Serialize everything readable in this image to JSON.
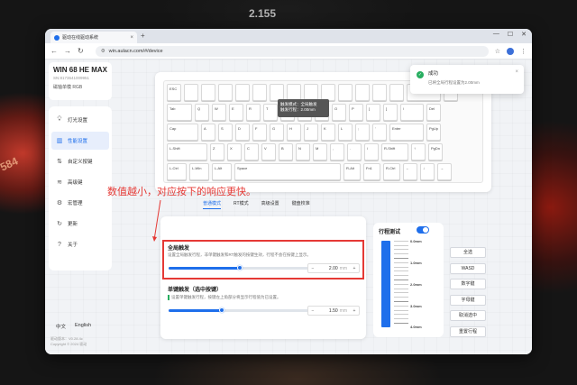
{
  "background": {
    "digits": "2.155",
    "side_text": "584"
  },
  "browser": {
    "tab_title": "驱动在线驱动系统",
    "url": "win.aulacn.com/#/device"
  },
  "device": {
    "name": "WIN 68 HE MAX",
    "sn": "SN:8173641009951",
    "mode": "磁轴单模 RGB"
  },
  "sidebar": {
    "items": [
      {
        "label": "灯光设置",
        "icon": "bulb-icon"
      },
      {
        "label": "性能设置",
        "icon": "bars-icon",
        "active": true
      },
      {
        "label": "自定义按键",
        "icon": "key-remap-icon"
      },
      {
        "label": "高级键",
        "icon": "wifi-icon"
      },
      {
        "label": "宏管理",
        "icon": "gear-icon"
      },
      {
        "label": "更新",
        "icon": "refresh-icon"
      },
      {
        "label": "关于",
        "icon": "question-icon"
      }
    ]
  },
  "language": {
    "zh": "中文",
    "en": "English"
  },
  "version": {
    "line1": "驱动版本：V0.28.4c",
    "line2": "Copyright © 2024 驱动"
  },
  "keyboard": {
    "rows": [
      [
        {
          "l": "ESC",
          "w": 16
        },
        {
          "l": "",
          "w": 16
        },
        {
          "l": "",
          "w": 16
        },
        {
          "l": "",
          "w": 16
        },
        {
          "l": "",
          "w": 16
        },
        {
          "l": "",
          "w": 16
        },
        {
          "l": "",
          "w": 16
        },
        {
          "l": "",
          "w": 16
        },
        {
          "l": "",
          "w": 16
        },
        {
          "l": "",
          "w": 16
        },
        {
          "l": "",
          "w": 16
        },
        {
          "l": "",
          "w": 16
        },
        {
          "l": "",
          "w": 16
        },
        {
          "l": "",
          "w": 16
        },
        {
          "l": "",
          "w": 38
        },
        {
          "l": "",
          "w": 16
        }
      ],
      [
        {
          "l": "Tab",
          "w": 28
        },
        {
          "l": "Q",
          "w": 16
        },
        {
          "l": "W",
          "w": 16
        },
        {
          "l": "E",
          "w": 16
        },
        {
          "l": "R",
          "w": 16
        },
        {
          "l": "T",
          "w": 16
        },
        {
          "l": "Y",
          "w": 16
        },
        {
          "l": "U",
          "w": 16
        },
        {
          "l": "I",
          "w": 16
        },
        {
          "l": "O",
          "w": 16
        },
        {
          "l": "P",
          "w": 16
        },
        {
          "l": "[",
          "w": 16
        },
        {
          "l": "]",
          "w": 16
        },
        {
          "l": "\\",
          "w": 26
        },
        {
          "l": "Del",
          "w": 16
        }
      ],
      [
        {
          "l": "Cap",
          "w": 35
        },
        {
          "l": "A",
          "w": 16
        },
        {
          "l": "S",
          "w": 16
        },
        {
          "l": "D",
          "w": 16
        },
        {
          "l": "F",
          "w": 16
        },
        {
          "l": "G",
          "w": 16
        },
        {
          "l": "H",
          "w": 16
        },
        {
          "l": "J",
          "w": 16
        },
        {
          "l": "K",
          "w": 16
        },
        {
          "l": "L",
          "w": 16
        },
        {
          "l": ";",
          "w": 16
        },
        {
          "l": "'",
          "w": 16
        },
        {
          "l": "Enter",
          "w": 38
        },
        {
          "l": "PgUp",
          "w": 16
        }
      ],
      [
        {
          "l": "L-Shift",
          "w": 45
        },
        {
          "l": "Z",
          "w": 16
        },
        {
          "l": "X",
          "w": 16
        },
        {
          "l": "C",
          "w": 16
        },
        {
          "l": "V",
          "w": 16
        },
        {
          "l": "B",
          "w": 16
        },
        {
          "l": "N",
          "w": 16
        },
        {
          "l": "M",
          "w": 16
        },
        {
          "l": ",",
          "w": 16
        },
        {
          "l": ".",
          "w": 16
        },
        {
          "l": "/",
          "w": 16
        },
        {
          "l": "R-Shift",
          "w": 30
        },
        {
          "l": "↑",
          "w": 16
        },
        {
          "l": "PgDn",
          "w": 16
        }
      ],
      [
        {
          "l": "L-Ctrl",
          "w": 22
        },
        {
          "l": "L-Win",
          "w": 22
        },
        {
          "l": "L-Alt",
          "w": 22
        },
        {
          "l": "Space",
          "w": 118
        },
        {
          "l": "R-Alt",
          "w": 19
        },
        {
          "l": "Fn1",
          "w": 19
        },
        {
          "l": "R-Ctrl",
          "w": 19
        },
        {
          "l": "←",
          "w": 16
        },
        {
          "l": "↓",
          "w": 16
        },
        {
          "l": "→",
          "w": 16
        }
      ]
    ],
    "tooltip": {
      "line1": "触发模式：全局触发",
      "line2": "触发行程：2.00mm"
    }
  },
  "toast": {
    "title": "成功",
    "desc": "已将全局行程设置为2.00mm"
  },
  "annotation": "数值越小，对应按下的响应更快。",
  "tabs": [
    {
      "label": "普通模式",
      "active": true
    },
    {
      "label": "RT模式"
    },
    {
      "label": "高级设置"
    },
    {
      "label": "键盘校准"
    }
  ],
  "global_trigger": {
    "title": "全局触发",
    "desc": "设置全局触发行程，非单键触发和RT触发的按键生效，行程不会在按键上显示。",
    "value": "2.00",
    "unit": "mm",
    "fraction": 0.5
  },
  "single_trigger": {
    "title": "单键触发（选中按键）",
    "desc": "设置单键触发行程，按键左上角部分将显示行程值为已设置。",
    "value": "1.50",
    "unit": "mm",
    "fraction": 0.375
  },
  "travel_test": {
    "title": "行程测试",
    "enabled": true,
    "labels": [
      "0.0mm",
      "1.0mm",
      "2.0mm",
      "3.0mm",
      "4.0mm"
    ]
  },
  "buttons": [
    "全选",
    "WASD",
    "数字键",
    "字母键",
    "取消选中",
    "重置行程"
  ]
}
